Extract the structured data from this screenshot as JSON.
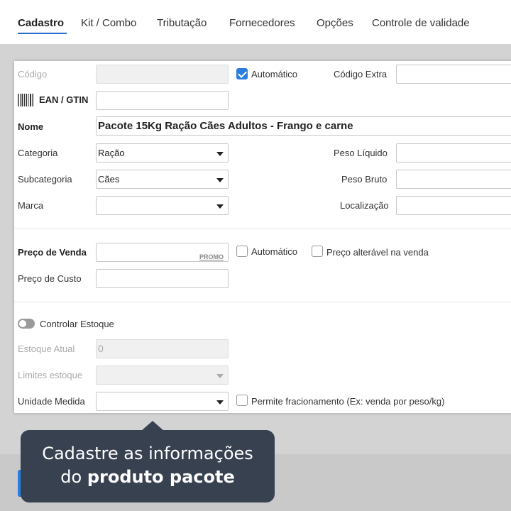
{
  "tabs": [
    {
      "label": "Cadastro",
      "active": true
    },
    {
      "label": "Kit / Combo"
    },
    {
      "label": "Tributação"
    },
    {
      "label": "Fornecedores"
    },
    {
      "label": "Opções"
    },
    {
      "label": "Controle de validade"
    }
  ],
  "form": {
    "codigo": {
      "label": "Código",
      "value": ""
    },
    "automatico_codigo": {
      "label": "Automático",
      "checked": true
    },
    "codigo_extra": {
      "label": "Código Extra",
      "value": ""
    },
    "ean": {
      "label": "EAN / GTIN",
      "value": "",
      "icon": "barcode-icon"
    },
    "nome": {
      "label": "Nome",
      "value": "Pacote 15Kg Ração Cães Adultos - Frango e carne"
    },
    "categoria": {
      "label": "Categoria",
      "value": "Ração"
    },
    "subcategoria": {
      "label": "Subcategoria",
      "value": "Cães"
    },
    "marca": {
      "label": "Marca",
      "value": ""
    },
    "peso_liquido": {
      "label": "Peso Líquido",
      "value": ""
    },
    "peso_bruto": {
      "label": "Peso Bruto",
      "value": ""
    },
    "localizacao": {
      "label": "Localização",
      "value": ""
    },
    "preco_venda": {
      "label": "Preço de Venda",
      "value": "",
      "promo": "PROMO"
    },
    "automatico_preco": {
      "label": "Automático",
      "checked": false
    },
    "preco_alteravel": {
      "label": "Preço alterável na venda",
      "checked": false
    },
    "preco_custo": {
      "label": "Preço de Custo",
      "value": ""
    },
    "controlar_estoque": {
      "label": "Controlar Estoque",
      "on": false
    },
    "estoque_atual": {
      "label": "Estoque Atual",
      "value": "0"
    },
    "limites_estoque": {
      "label": "Limites estoque",
      "value": ""
    },
    "unidade_medida": {
      "label": "Unidade Medida",
      "value": ""
    },
    "permite_fracionamento": {
      "label": "Permite fracionamento (Ex: venda por peso/kg)",
      "checked": false
    }
  },
  "tooltip": {
    "line1": "Cadastre as informações",
    "line2_prefix": "do",
    "line2_bold": "produto pacote"
  },
  "colors": {
    "accent": "#2a7de1",
    "tooltip_bg": "#384150"
  }
}
